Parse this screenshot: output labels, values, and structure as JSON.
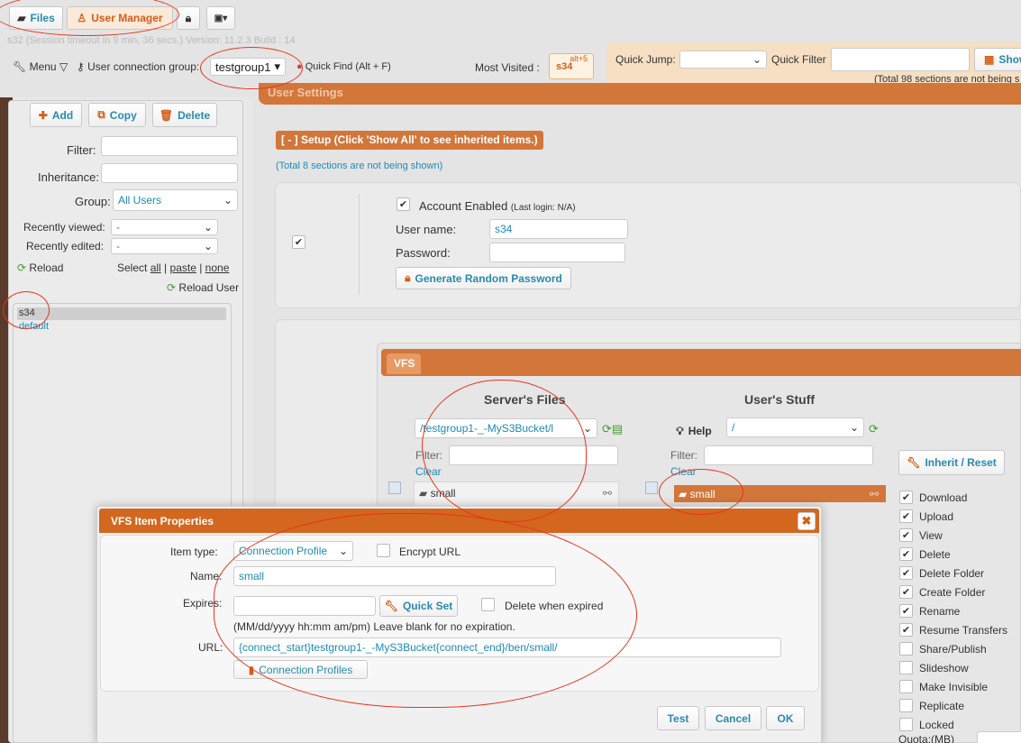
{
  "top_tabs": {
    "files": "Files",
    "user_manager": "User Manager"
  },
  "status_line": "s32 (Session timeout in 9 min, 36 secs.) Version: 11.2.3 Build : 14",
  "menu": "Menu",
  "connection_group_label": "User connection group:",
  "connection_group_value": "testgroup1",
  "quick_find": "Quick Find (Alt + F)",
  "most_visited_label": "Most Visited :",
  "most_visited_badge": {
    "hint": "alt+5",
    "value": "s34"
  },
  "quick_jump_label": "Quick Jump:",
  "quick_filter_label": "Quick Filter",
  "show_button": "Show",
  "total_hidden": "(Total 98 sections are not being s",
  "left": {
    "add": "Add",
    "copy": "Copy",
    "delete": "Delete",
    "filter_label": "Filter:",
    "inheritance_label": "Inheritance:",
    "group_label": "Group:",
    "group_value": "All Users",
    "recent_viewed_label": "Recently viewed:",
    "recent_viewed_value": "-",
    "recent_edited_label": "Recently edited:",
    "recent_edited_value": "-",
    "reload": "Reload",
    "select_prefix": "Select",
    "select_all": "all",
    "select_paste": "paste",
    "select_none": "none",
    "reload_user": "Reload User",
    "users": [
      "s34",
      "default"
    ]
  },
  "settings_header": "User Settings",
  "setup_header": "[ - ] Setup (Click 'Show All' to see inherited items.)",
  "setup_total": "(Total 8 sections are not being shown)",
  "account_enabled": "Account Enabled",
  "last_login": "(Last login: N/A)",
  "username_label": "User name:",
  "username_value": "s34",
  "password_label": "Password:",
  "gen_password": "Generate Random Password",
  "vfs_tab": "VFS",
  "servers_files": "Server's Files",
  "users_stuff": "User's Stuff",
  "server_path": "/testgroup1-_-MyS3Bucket/l",
  "help": "Help",
  "user_path": "/",
  "filter_label": "Filter:",
  "clear": "Clear",
  "server_item": "small",
  "user_item": "small",
  "inherit_reset": "Inherit / Reset",
  "permissions": [
    {
      "label": "Download",
      "checked": true
    },
    {
      "label": "Upload",
      "checked": true
    },
    {
      "label": "View",
      "checked": true
    },
    {
      "label": "Delete",
      "checked": true
    },
    {
      "label": "Delete Folder",
      "checked": true
    },
    {
      "label": "Create Folder",
      "checked": true
    },
    {
      "label": "Rename",
      "checked": true
    },
    {
      "label": "Resume Transfers",
      "checked": true
    },
    {
      "label": "Share/Publish",
      "checked": false
    },
    {
      "label": "Slideshow",
      "checked": false
    },
    {
      "label": "Make Invisible",
      "checked": false
    },
    {
      "label": "Replicate",
      "checked": false
    },
    {
      "label": "Locked",
      "checked": false
    }
  ],
  "quota": "Quota:(MB)",
  "dialog": {
    "title": "VFS Item Properties",
    "item_type_label": "Item type:",
    "item_type_value": "Connection Profile",
    "encrypt_url": "Encrypt URL",
    "name_label": "Name:",
    "name_value": "small",
    "expires_label": "Expires:",
    "quick_set": "Quick Set",
    "delete_when_expired": "Delete when expired",
    "expires_hint": "(MM/dd/yyyy hh:mm am/pm) Leave blank for no expiration.",
    "url_label": "URL:",
    "url_value": "{connect_start}testgroup1-_-MyS3Bucket{connect_end}/ben/small/",
    "connection_profiles": "Connection Profiles",
    "test": "Test",
    "cancel": "Cancel",
    "ok": "OK"
  }
}
